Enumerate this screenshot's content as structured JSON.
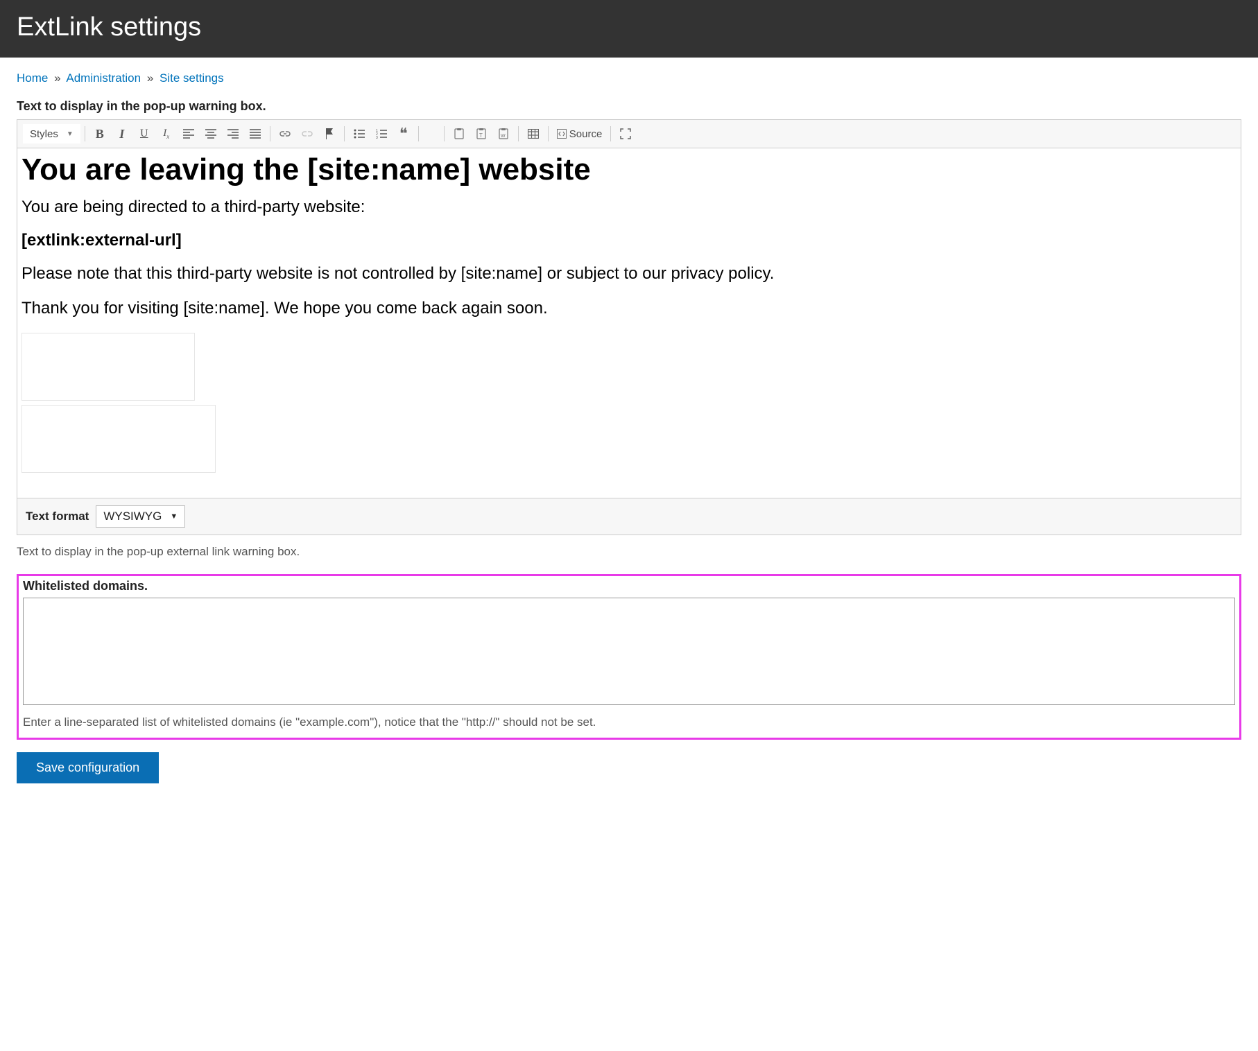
{
  "header": {
    "title": "ExtLink settings"
  },
  "breadcrumb": {
    "items": [
      "Home",
      "Administration",
      "Site settings"
    ],
    "separator": "»"
  },
  "popup_field": {
    "label": "Text to display in the pop-up warning box.",
    "description": "Text to display in the pop-up external link warning box."
  },
  "toolbar": {
    "styles_label": "Styles",
    "source_label": "Source"
  },
  "editor_content": {
    "heading": "You are leaving the [site:name] website",
    "p1": "You are being directed to a third-party website:",
    "token": "[extlink:external-url]",
    "p2": "Please note that this third-party website is not controlled by [site:name] or subject to our privacy policy.",
    "p3": "Thank you for visiting [site:name]. We hope you come back again soon."
  },
  "text_format": {
    "label": "Text format",
    "selected": "WYSIWYG"
  },
  "whitelist": {
    "label": "Whitelisted domains.",
    "value": "",
    "description": "Enter a line-separated list of whitelisted domains (ie \"example.com\"), notice that the \"http://\" should not be set."
  },
  "save_button": {
    "label": "Save configuration"
  }
}
